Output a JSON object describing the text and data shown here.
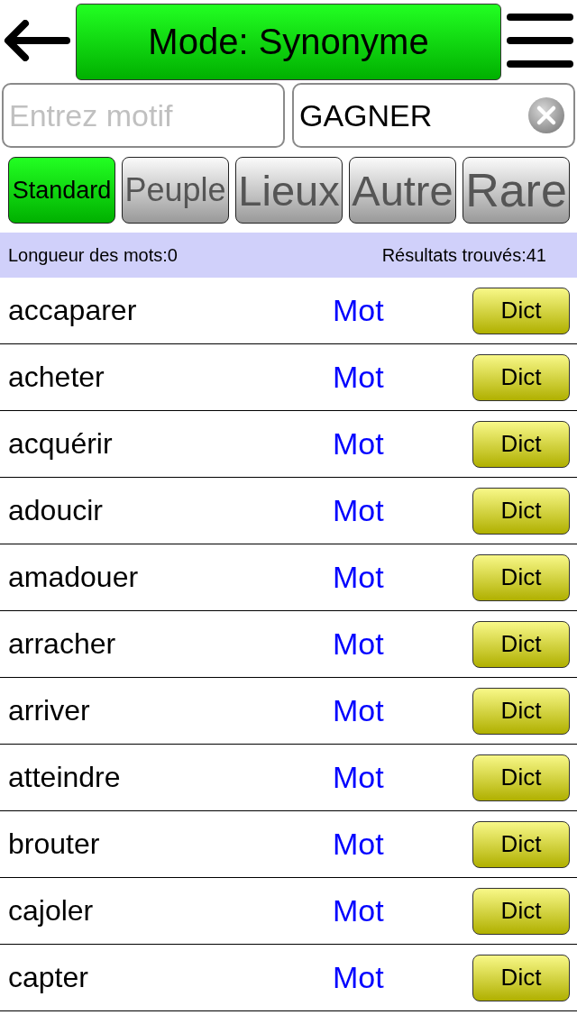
{
  "header": {
    "mode_button": "Mode: Synonyme"
  },
  "search": {
    "pattern_field": {
      "placeholder": "Entrez motif"
    },
    "word_field": {
      "value": "GAGNER"
    }
  },
  "filters": [
    {
      "label": "Standard",
      "selected": true
    },
    {
      "label": "Peuple",
      "selected": false
    },
    {
      "label": "Lieux",
      "selected": false
    },
    {
      "label": "Autre",
      "selected": false
    },
    {
      "label": "Rare",
      "selected": false
    }
  ],
  "info_bar": {
    "word_length": "Longueur des mots:0",
    "results_found": "Résultats trouvés:41"
  },
  "results": [
    {
      "word": "accaparer",
      "link": "Mot",
      "button": "Dict"
    },
    {
      "word": "acheter",
      "link": "Mot",
      "button": "Dict"
    },
    {
      "word": "acquérir",
      "link": "Mot",
      "button": "Dict"
    },
    {
      "word": "adoucir",
      "link": "Mot",
      "button": "Dict"
    },
    {
      "word": "amadouer",
      "link": "Mot",
      "button": "Dict"
    },
    {
      "word": "arracher",
      "link": "Mot",
      "button": "Dict"
    },
    {
      "word": "arriver",
      "link": "Mot",
      "button": "Dict"
    },
    {
      "word": "atteindre",
      "link": "Mot",
      "button": "Dict"
    },
    {
      "word": "brouter",
      "link": "Mot",
      "button": "Dict"
    },
    {
      "word": "cajoler",
      "link": "Mot",
      "button": "Dict"
    },
    {
      "word": "capter",
      "link": "Mot",
      "button": "Dict"
    }
  ]
}
